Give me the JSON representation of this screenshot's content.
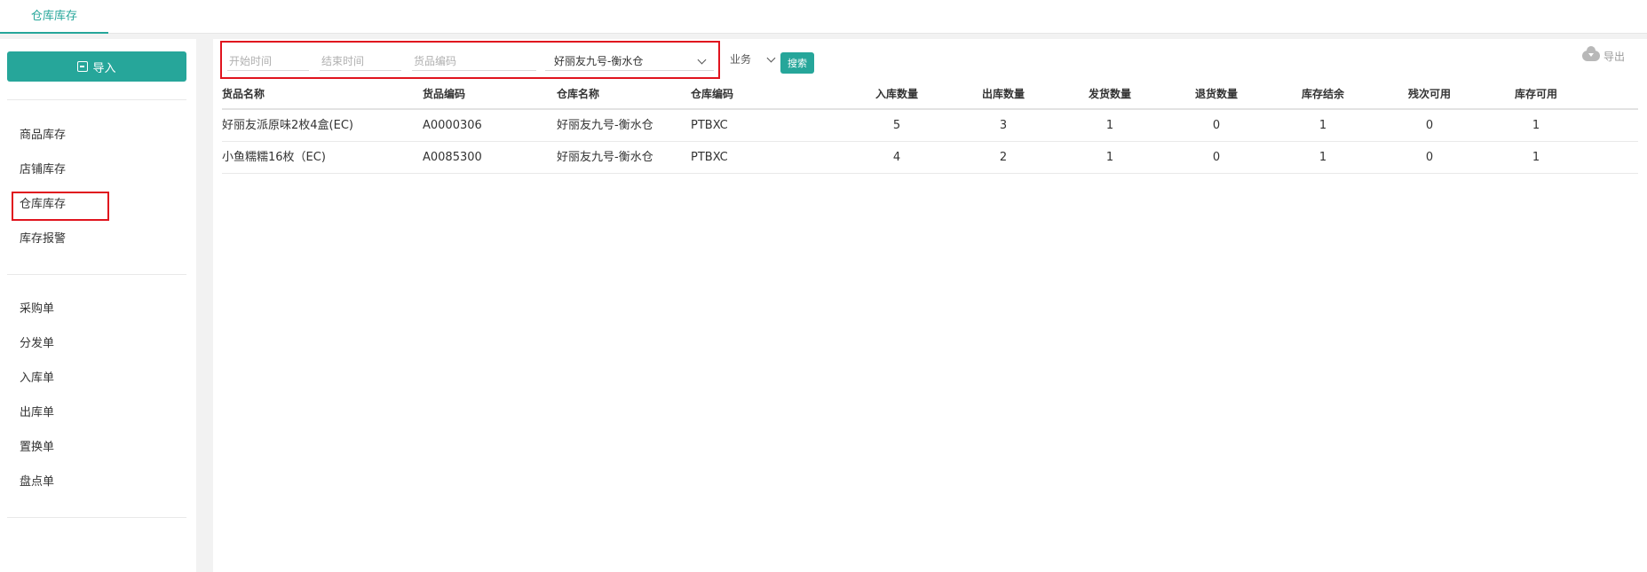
{
  "tabs": {
    "active_label": "仓库库存"
  },
  "sidebar": {
    "import_label": "导入",
    "items_group1": [
      "商品库存",
      "店铺库存",
      "仓库库存",
      "库存报警"
    ],
    "items_group2": [
      "采购单",
      "分发单",
      "入库单",
      "出库单",
      "置换单",
      "盘点单"
    ]
  },
  "filters": {
    "start_placeholder": "开始时间",
    "end_placeholder": "结束时间",
    "code_placeholder": "货品编码",
    "warehouse_value": "好丽友九号-衡水仓",
    "biz_value": "业务",
    "search_label": "搜索",
    "export_label": "导出"
  },
  "table": {
    "headers": [
      "货品名称",
      "货品编码",
      "仓库名称",
      "仓库编码",
      "入库数量",
      "出库数量",
      "发货数量",
      "退货数量",
      "库存结余",
      "残次可用",
      "库存可用"
    ],
    "rows": [
      [
        "好丽友派原味2枚4盒(EC)",
        "A0000306",
        "好丽友九号-衡水仓",
        "PTBXC",
        "5",
        "3",
        "1",
        "0",
        "1",
        "0",
        "1"
      ],
      [
        "小鱼糯糯16枚（EC)",
        "A0085300",
        "好丽友九号-衡水仓",
        "PTBXC",
        "4",
        "2",
        "1",
        "0",
        "1",
        "0",
        "1"
      ]
    ]
  },
  "colors": {
    "accent": "#26a69a",
    "highlight": "#e0141e"
  }
}
